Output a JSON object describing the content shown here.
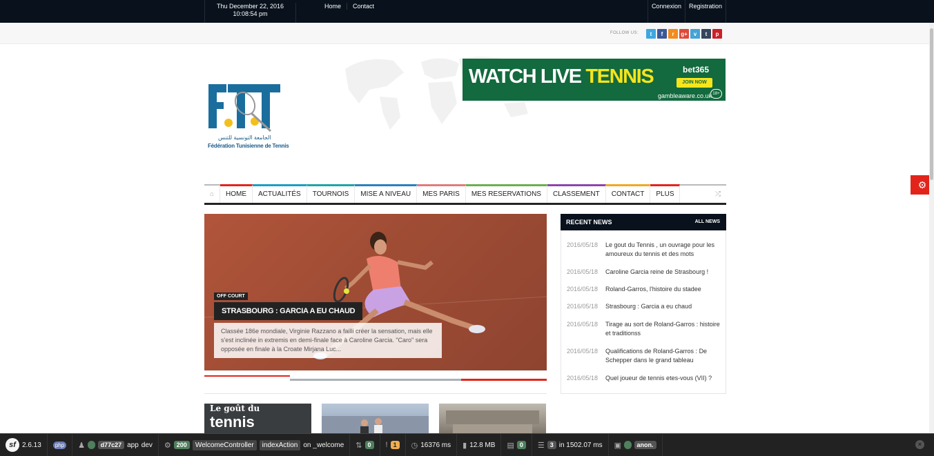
{
  "topbar": {
    "date_line1": "Thu December 22, 2016",
    "date_line2": "10:08:54 pm",
    "nav": [
      "Home",
      "Contact"
    ],
    "user_links": [
      "Connexion",
      "Registration"
    ]
  },
  "follow": {
    "label": "FOLLOW US:",
    "networks": [
      {
        "icon": "twitter-icon",
        "glyph": "t",
        "color": "#3fa7e0"
      },
      {
        "icon": "facebook-icon",
        "glyph": "f",
        "color": "#3b5998"
      },
      {
        "icon": "rss-icon",
        "glyph": "r",
        "color": "#f28c1d"
      },
      {
        "icon": "google-plus-icon",
        "glyph": "g+",
        "color": "#dd4b39"
      },
      {
        "icon": "vimeo-icon",
        "glyph": "v",
        "color": "#44a3d7"
      },
      {
        "icon": "tumblr-icon",
        "glyph": "t",
        "color": "#35465c"
      },
      {
        "icon": "pinterest-icon",
        "glyph": "p",
        "color": "#cb2027"
      }
    ]
  },
  "logo": {
    "arabic": "الجامعة التونسية للتنس",
    "subtitle": "Fédération Tunisienne de Tennis"
  },
  "ad": {
    "watch": "WATCH LIVE ",
    "tennis": "TENNIS",
    "brand": "bet365",
    "join": "JOIN NOW",
    "aware": "gambleaware.co.uk",
    "age": "18+"
  },
  "nav": {
    "items": [
      {
        "label": "HOME",
        "color": "#e2241b"
      },
      {
        "label": "ACTUALITÉS",
        "color": "#1a9fc4"
      },
      {
        "label": "TOURNOIS",
        "color": "#1aa6a5"
      },
      {
        "label": "MISE A NIVEAU",
        "color": "#2c7fc0"
      },
      {
        "label": "MES PARIS",
        "color": "#e07a7a"
      },
      {
        "label": "MES RESERVATIONS",
        "color": "#6ab04c"
      },
      {
        "label": "CLASSEMENT",
        "color": "#8e44ad"
      },
      {
        "label": "CONTACT",
        "color": "#f0a920"
      },
      {
        "label": "PLUS",
        "color": "#e2241b"
      }
    ]
  },
  "slider": {
    "tag": "OFF COURT",
    "title": "STRASBOURG : GARCIA A EU CHAUD",
    "description": "Classée 186e mondiale, Virginie Razzano a failli créer la sensation, mais elle s'est inclinée in extremis en demi-finale face à Caroline Garcia. \"Caro\" sera opposée en finale à la Croate Mirjana Luc..."
  },
  "thumbs": {
    "first_line1": "Le goût du",
    "first_line2": "tennis"
  },
  "recent": {
    "title": "RECENT NEWS",
    "all_link": "ALL NEWS",
    "items": [
      {
        "date": "2016/05/18",
        "title": "Le gout du Tennis , un ouvrage pour les amoureux du tennis et des mots"
      },
      {
        "date": "2016/05/18",
        "title": "Caroline Garcia reine de Strasbourg !"
      },
      {
        "date": "2016/05/18",
        "title": "Roland-Garros, l'histoire du stadee"
      },
      {
        "date": "2016/05/18",
        "title": "Strasbourg : Garcia a eu chaud"
      },
      {
        "date": "2016/05/18",
        "title": "Tirage au sort de Roland-Garros : histoire et traditionss"
      },
      {
        "date": "2016/05/18",
        "title": "Qualifications de Roland-Garros : De Schepper dans le grand tableau"
      },
      {
        "date": "2016/05/18",
        "title": "Quel joueur de tennis etes-vous (VII) ?"
      }
    ]
  },
  "symfony": {
    "version": "2.6.13",
    "php": "php",
    "token": "d77c27",
    "env_app": "app",
    "env_dev": "dev",
    "status": "200",
    "controller": "WelcomeController",
    "action": "indexAction",
    "route": "on _welcome",
    "redirects": "0",
    "errors": "1",
    "time": "16376 ms",
    "memory": "12.8 MB",
    "forms": "0",
    "queries": "3",
    "query_time": "in 1502.07 ms",
    "security": "0",
    "user": "anon."
  }
}
